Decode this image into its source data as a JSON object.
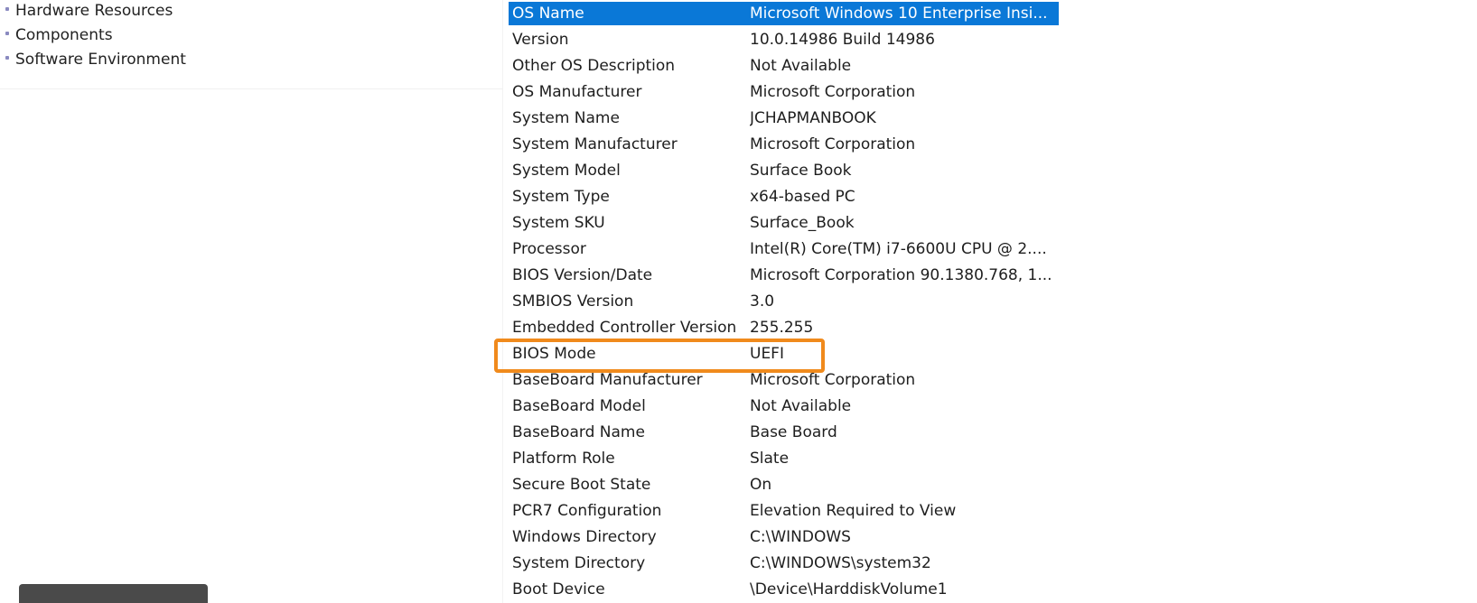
{
  "tree": {
    "items": [
      {
        "label": "Hardware Resources"
      },
      {
        "label": "Components"
      },
      {
        "label": "Software Environment"
      }
    ]
  },
  "details": {
    "rows": [
      {
        "item": "OS Name",
        "value": "Microsoft Windows 10 Enterprise Insi...",
        "selected": true
      },
      {
        "item": "Version",
        "value": "10.0.14986 Build 14986"
      },
      {
        "item": "Other OS Description",
        "value": "Not Available"
      },
      {
        "item": "OS Manufacturer",
        "value": "Microsoft Corporation"
      },
      {
        "item": "System Name",
        "value": "JCHAPMANBOOK"
      },
      {
        "item": "System Manufacturer",
        "value": "Microsoft Corporation"
      },
      {
        "item": "System Model",
        "value": "Surface Book"
      },
      {
        "item": "System Type",
        "value": "x64-based PC"
      },
      {
        "item": "System SKU",
        "value": "Surface_Book"
      },
      {
        "item": "Processor",
        "value": "Intel(R) Core(TM) i7-6600U CPU @ 2...."
      },
      {
        "item": "BIOS Version/Date",
        "value": "Microsoft Corporation 90.1380.768, 1..."
      },
      {
        "item": "SMBIOS Version",
        "value": "3.0"
      },
      {
        "item": "Embedded Controller Version",
        "value": "255.255"
      },
      {
        "item": "BIOS Mode",
        "value": "UEFI",
        "highlighted": true
      },
      {
        "item": "BaseBoard Manufacturer",
        "value": "Microsoft Corporation"
      },
      {
        "item": "BaseBoard Model",
        "value": "Not Available"
      },
      {
        "item": "BaseBoard Name",
        "value": "Base Board"
      },
      {
        "item": "Platform Role",
        "value": "Slate"
      },
      {
        "item": "Secure Boot State",
        "value": "On"
      },
      {
        "item": "PCR7 Configuration",
        "value": "Elevation Required to View"
      },
      {
        "item": "Windows Directory",
        "value": "C:\\WINDOWS"
      },
      {
        "item": "System Directory",
        "value": "C:\\WINDOWS\\system32"
      },
      {
        "item": "Boot Device",
        "value": "\\Device\\HarddiskVolume1"
      }
    ]
  },
  "colors": {
    "selection": "#0a78d7",
    "highlight_box": "#f08a1c"
  }
}
